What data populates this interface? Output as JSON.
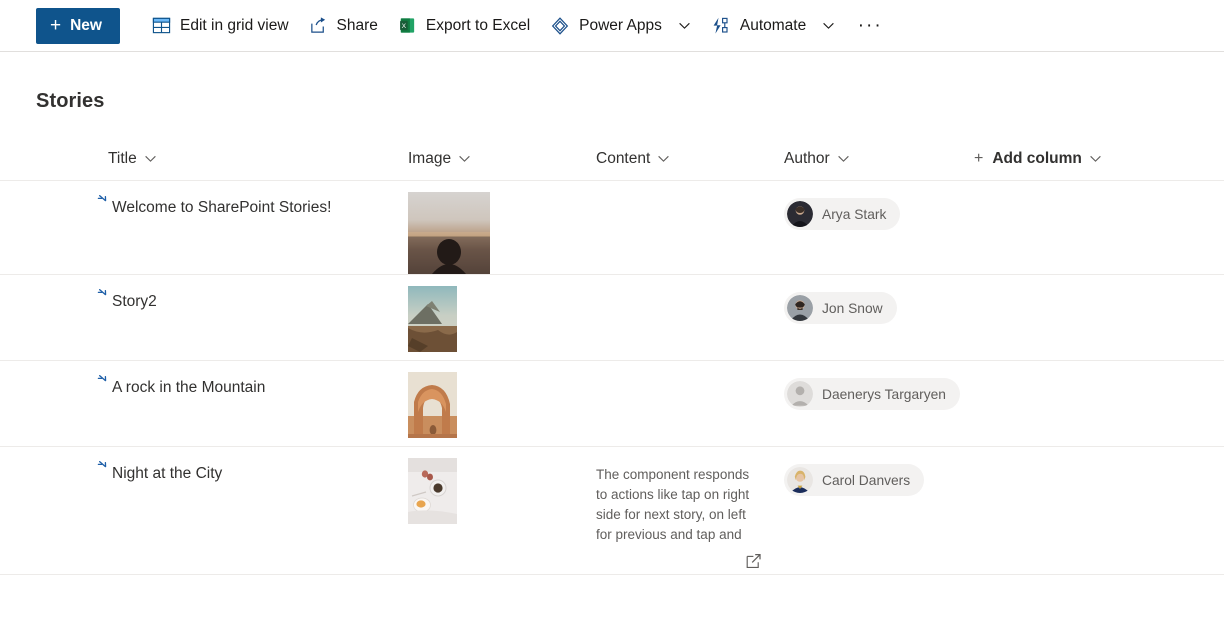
{
  "commandbar": {
    "new_label": "New",
    "items": [
      {
        "icon": "grid-icon",
        "label": "Edit in grid view",
        "chevron": false
      },
      {
        "icon": "share-icon",
        "label": "Share",
        "chevron": false
      },
      {
        "icon": "excel-icon",
        "label": "Export to Excel",
        "chevron": false
      },
      {
        "icon": "powerapps-icon",
        "label": "Power Apps",
        "chevron": true
      },
      {
        "icon": "automate-icon",
        "label": "Automate",
        "chevron": true
      }
    ],
    "overflow_label": "···"
  },
  "page": {
    "title": "Stories"
  },
  "list": {
    "columns": [
      {
        "label": "Title",
        "sortable": true,
        "add": false
      },
      {
        "label": "Image",
        "sortable": true,
        "add": false
      },
      {
        "label": "Content",
        "sortable": true,
        "add": false
      },
      {
        "label": "Author",
        "sortable": true,
        "add": false
      },
      {
        "label": "Add column",
        "sortable": true,
        "add": true
      }
    ],
    "rows": [
      {
        "title": "Welcome to SharePoint Stories!",
        "image": "city-sunset-silhouette",
        "content": "",
        "author": "Arya Stark",
        "has_photo": true
      },
      {
        "title": "Story2",
        "image": "mountain-volcano",
        "content": "",
        "author": "Jon Snow",
        "has_photo": true
      },
      {
        "title": "A rock in the Mountain",
        "image": "sandstone-arch",
        "content": "",
        "author": "Daenerys Targaryen",
        "has_photo": false
      },
      {
        "title": "Night at the City",
        "image": "coffee-table-flatlay",
        "content": "The component responds to actions like tap on right side for next story, on left for previous and tap and",
        "author": "Carol Danvers",
        "has_photo": true
      }
    ]
  },
  "colors": {
    "accent": "#0f548c",
    "excel_green": "#217346",
    "link_blue": "#0078d4",
    "text_primary": "#323130",
    "text_secondary": "#605e5c",
    "chip_bg": "#f3f2f1",
    "border": "#edebe9"
  }
}
